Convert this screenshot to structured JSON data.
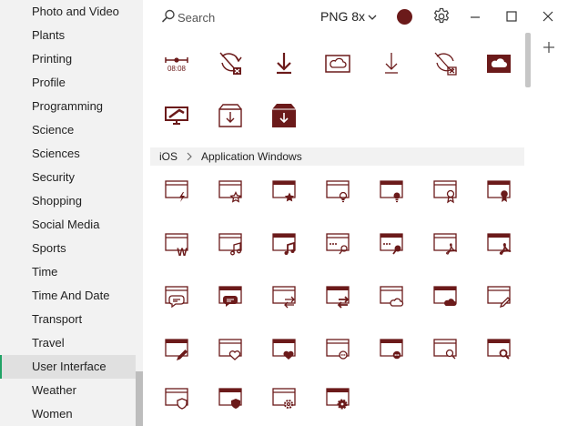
{
  "sidebar": {
    "categories": [
      "Photo and Video",
      "Plants",
      "Printing",
      "Profile",
      "Programming",
      "Science",
      "Sciences",
      "Security",
      "Shopping",
      "Social Media",
      "Sports",
      "Time",
      "Time And Date",
      "Transport",
      "Travel",
      "User Interface",
      "Weather",
      "Women"
    ],
    "active": "User Interface"
  },
  "toolbar": {
    "search_placeholder": "Search",
    "format_label": "PNG 8x",
    "color": "#6b1a1a"
  },
  "breadcrumb": {
    "platform": "iOS",
    "category": "Application Windows"
  },
  "colors": {
    "icon": "#6b1a1a",
    "accent": "#21a366",
    "sidebar_bg": "#f2f2f2"
  },
  "results_icons": [
    "timeline-icon",
    "no-sync-icon",
    "download-icon",
    "cloud-icon",
    "download-outline-icon",
    "no-sync-box-icon",
    "cloud-filled-icon",
    "computer-support-icon",
    "download-box-icon",
    "download-box-filled-icon"
  ],
  "grid_icons": [
    "app-window-flash",
    "app-window-star",
    "app-window-star-filled",
    "app-window-bulb",
    "app-window-bulb-filled",
    "app-window-award",
    "app-window-award-filled",
    "app-window-word",
    "app-window-music",
    "app-window-music-filled",
    "app-window-password",
    "app-window-password-filled",
    "app-window-pdf",
    "app-window-pdf-filled",
    "app-window-chat",
    "app-window-chat-filled",
    "app-window-transfer",
    "app-window-transfer-filled",
    "app-window-cloud",
    "app-window-cloud-filled",
    "app-window-pen",
    "app-window-pen-filled",
    "app-window-heart",
    "app-window-heart-filled",
    "app-window-dots",
    "app-window-dots-filled",
    "app-window-search",
    "app-window-search-filled",
    "app-window-shield",
    "app-window-shield-filled",
    "app-window-gear",
    "app-window-gear-filled"
  ]
}
